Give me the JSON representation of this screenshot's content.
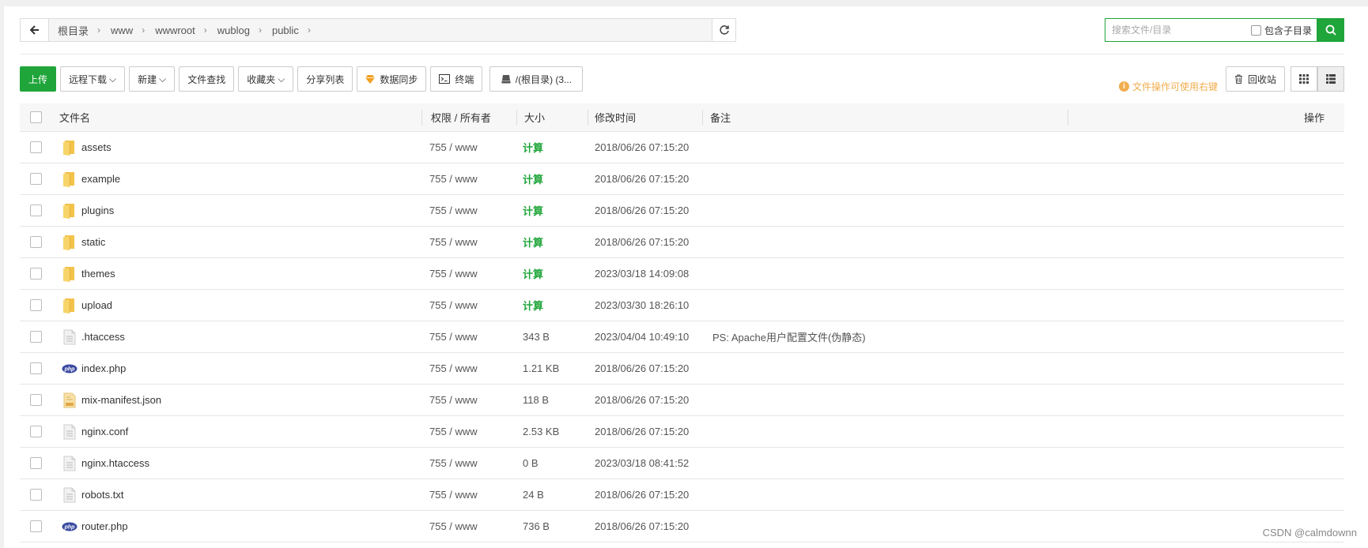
{
  "breadcrumb": {
    "segments": [
      "根目录",
      "www",
      "wwwroot",
      "wublog",
      "public"
    ],
    "back_icon": "arrow-left-icon",
    "refresh_icon": "refresh-icon"
  },
  "search": {
    "placeholder": "搜索文件/目录",
    "subdir_label": "包含子目录",
    "button_icon": "search-icon"
  },
  "toolbar": {
    "upload": "上传",
    "remote_download": "远程下载",
    "new": "新建",
    "file_search": "文件查找",
    "favorites": "收藏夹",
    "share_list": "分享列表",
    "data_sync": "数据同步",
    "terminal": "终端",
    "disk": "/(根目录) (3..."
  },
  "tip": "文件操作可使用右键",
  "recycle_bin": "回收站",
  "colors": {
    "accent": "#20a53a",
    "warning": "#f0ad4e",
    "folder": "#f6c94f"
  },
  "table": {
    "headers": {
      "name": "文件名",
      "perm": "权限 / 所有者",
      "size": "大小",
      "mtime": "修改时间",
      "note": "备注",
      "op": "操作"
    },
    "rows": [
      {
        "type": "folder",
        "name": "assets",
        "perm": "755 / www",
        "size": "计算",
        "mtime": "2018/06/26 07:15:20",
        "note": ""
      },
      {
        "type": "folder",
        "name": "example",
        "perm": "755 / www",
        "size": "计算",
        "mtime": "2018/06/26 07:15:20",
        "note": ""
      },
      {
        "type": "folder",
        "name": "plugins",
        "perm": "755 / www",
        "size": "计算",
        "mtime": "2018/06/26 07:15:20",
        "note": ""
      },
      {
        "type": "folder",
        "name": "static",
        "perm": "755 / www",
        "size": "计算",
        "mtime": "2018/06/26 07:15:20",
        "note": ""
      },
      {
        "type": "folder",
        "name": "themes",
        "perm": "755 / www",
        "size": "计算",
        "mtime": "2023/03/18 14:09:08",
        "note": ""
      },
      {
        "type": "folder",
        "name": "upload",
        "perm": "755 / www",
        "size": "计算",
        "mtime": "2023/03/30 18:26:10",
        "note": ""
      },
      {
        "type": "file",
        "name": ".htaccess",
        "perm": "755 / www",
        "size": "343 B",
        "mtime": "2023/04/04 10:49:10",
        "note": "PS: Apache用户配置文件(伪静态)"
      },
      {
        "type": "php",
        "name": "index.php",
        "perm": "755 / www",
        "size": "1.21 KB",
        "mtime": "2018/06/26 07:15:20",
        "note": ""
      },
      {
        "type": "json",
        "name": "mix-manifest.json",
        "perm": "755 / www",
        "size": "118 B",
        "mtime": "2018/06/26 07:15:20",
        "note": ""
      },
      {
        "type": "file",
        "name": "nginx.conf",
        "perm": "755 / www",
        "size": "2.53 KB",
        "mtime": "2018/06/26 07:15:20",
        "note": ""
      },
      {
        "type": "file",
        "name": "nginx.htaccess",
        "perm": "755 / www",
        "size": "0 B",
        "mtime": "2023/03/18 08:41:52",
        "note": ""
      },
      {
        "type": "file",
        "name": "robots.txt",
        "perm": "755 / www",
        "size": "24 B",
        "mtime": "2018/06/26 07:15:20",
        "note": ""
      },
      {
        "type": "php",
        "name": "router.php",
        "perm": "755 / www",
        "size": "736 B",
        "mtime": "2018/06/26 07:15:20",
        "note": ""
      }
    ]
  },
  "watermark": "CSDN @calmdownn"
}
